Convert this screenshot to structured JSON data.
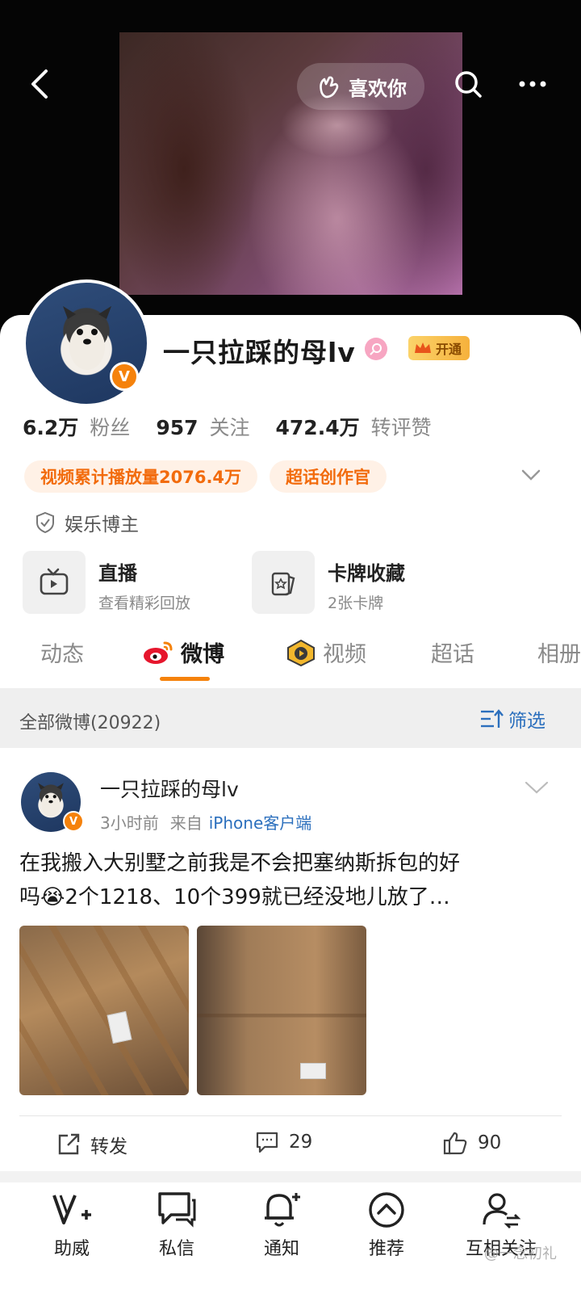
{
  "header": {
    "like_label": "喜欢你",
    "back_icon": "chevron-left-icon",
    "search_icon": "search-icon",
    "more_icon": "more-dots-icon"
  },
  "profile": {
    "name": "一只拉踩的母lv",
    "vip_label": "开通",
    "stats": [
      {
        "value": "6.2万",
        "label": "粉丝"
      },
      {
        "value": "957",
        "label": "关注"
      },
      {
        "value": "472.4万",
        "label": "转评赞"
      }
    ],
    "tags": [
      "视频累计播放量2076.4万",
      "超话创作官"
    ],
    "category": "娱乐博主",
    "tiles": [
      {
        "title": "直播",
        "subtitle": "查看精彩回放"
      },
      {
        "title": "卡牌收藏",
        "subtitle": "2张卡牌"
      }
    ]
  },
  "tabs": [
    "动态",
    "微博",
    "视频",
    "超话",
    "相册"
  ],
  "filter": {
    "label": "全部微博(20922)",
    "button": "筛选"
  },
  "post": {
    "author": "一只拉踩的母lv",
    "time": "3小时前",
    "from_label": "来自",
    "source": "iPhone客户端",
    "text_line1": "在我搬入大别墅之前我是不会把塞纳斯拆包的好",
    "text_line2": "吗😭2个1218、10个399就已经没地儿放了…",
    "actions": [
      {
        "label": "转发"
      },
      {
        "label": "29"
      },
      {
        "label": "90"
      }
    ]
  },
  "bottom_nav": [
    "助威",
    "私信",
    "通知",
    "推荐",
    "互相关注"
  ],
  "watermark": "@一念初礼",
  "colors": {
    "accent": "#f5820c",
    "link": "#2b6fbd"
  }
}
